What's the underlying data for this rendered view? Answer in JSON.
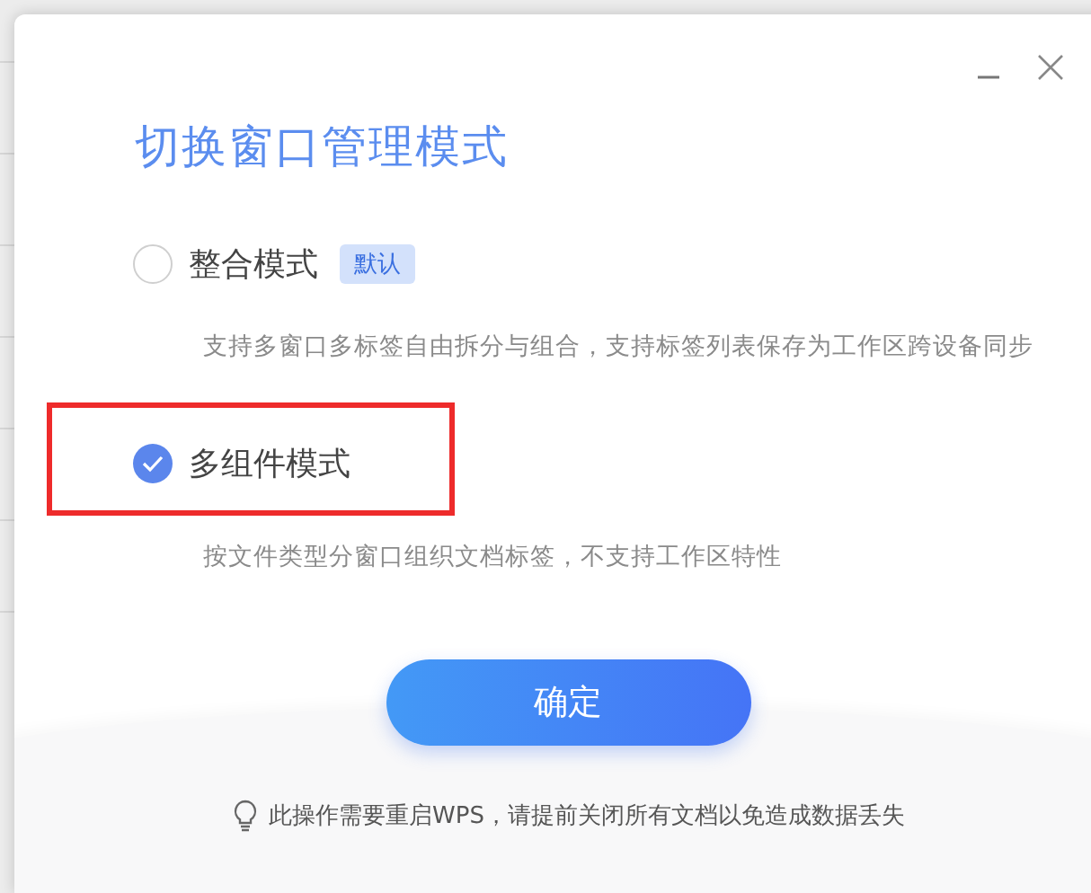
{
  "dialog": {
    "title": "切换窗口管理模式",
    "controls": [
      {
        "kind": "minimize"
      },
      {
        "kind": "close"
      }
    ]
  },
  "options": [
    {
      "label": "整合模式",
      "badge": "默认",
      "description": "支持多窗口多标签自由拆分与组合，支持标签列表保存为工作区跨设备同步",
      "selected": false,
      "highlighted": false
    },
    {
      "label": "多组件模式",
      "description": "按文件类型分窗口组织文档标签，不支持工作区特性",
      "selected": true,
      "highlighted": true
    }
  ],
  "confirm_button": "确定",
  "note": "此操作需要重启WPS，请提前关闭所有文档以免造成数据丢失"
}
